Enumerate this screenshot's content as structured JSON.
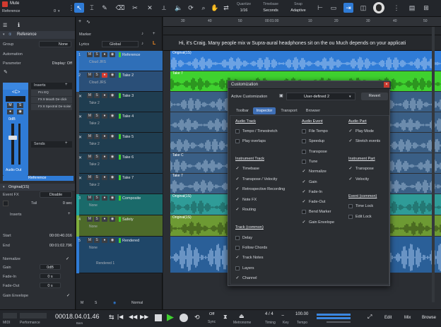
{
  "toolbar": {
    "mute_label": "Mute",
    "track_name": "Reference",
    "counter": "0",
    "quantize_label": "Quantize",
    "quantize_value": "1/16",
    "timebase_label": "Timebase",
    "timebase_value": "Seconds",
    "snap_label": "Snap",
    "snap_value": "Adaptive"
  },
  "inspector": {
    "title": "Reference",
    "group_label": "Group",
    "group_value": "None",
    "automation_label": "Automation",
    "parameter_label": "Parameter",
    "parameter_value": "Display: Off",
    "inserts_label": "Inserts",
    "insert_items": [
      "Pro EQ",
      "FX 9 Mouth De-click",
      "FX 8 Spectral De-noise"
    ],
    "channel_label": "<C>",
    "fader_value": "0dB",
    "sends_label": "Sends",
    "audio_out": "Audio Out",
    "channel_name": "Reference",
    "event_name": "Original(1S)",
    "event_fx_label": "Event FX",
    "event_fx_value": "Disable",
    "tail_label": "Tail",
    "tail_value": "0 sec",
    "event_inserts": "Inserts",
    "start_label": "Start",
    "start_value": "00:00:40.016",
    "end_label": "End",
    "end_value": "00:01:02.796",
    "normalize_label": "Normalize",
    "gain_label": "Gain",
    "gain_value": "0dB",
    "fadein_label": "Fade-In",
    "fadein_value": "0 s",
    "fadeout_label": "Fade-Out",
    "fadeout_value": "0 s",
    "gain_env_label": "Gain Envelope"
  },
  "tracklist": {
    "marker_label": "Marker",
    "lyrics_label": "Lyrics",
    "lyrics_value": "Global",
    "tracks": [
      {
        "num": "1",
        "name": "Reference",
        "sub": "Cloud JRS",
        "color": "#2f7bd6"
      },
      {
        "num": "2",
        "name": "Take 2",
        "sub": "Cloud JRS",
        "color": "#2f7bd6"
      },
      {
        "num": "",
        "name": "Take 3",
        "sub": "Take 2",
        "color": "#3a3e44"
      },
      {
        "num": "",
        "name": "Take 4",
        "sub": "Take 2",
        "color": "#3a3e44"
      },
      {
        "num": "",
        "name": "Take 5",
        "sub": "Take 2",
        "color": "#3a3e44"
      },
      {
        "num": "",
        "name": "Take 6",
        "sub": "Take 2",
        "color": "#3a3e44"
      },
      {
        "num": "",
        "name": "Take 7",
        "sub": "Take 2",
        "color": "#3a3e44"
      },
      {
        "num": "3",
        "name": "Composite",
        "sub": "None",
        "color": "#23a5a0"
      },
      {
        "num": "4",
        "name": "Safety",
        "sub": "None",
        "color": "#7fae3b"
      },
      {
        "num": "5",
        "name": "Rendered",
        "sub": "None",
        "color": "#2f7bd6"
      }
    ],
    "rendered_sub": "Rendered 1",
    "bottom_mode": "Normal"
  },
  "arrange": {
    "ruler": [
      "30",
      "40",
      "50",
      "00:01:00",
      "10",
      "20",
      "30",
      "40",
      "50"
    ],
    "lyrics_text": "Hi, it's Craig. Many people mix w Supra-aural headphones sit on the ou Much depends on your applicati",
    "clip_label": "Original(1S)",
    "take_label": "Take 7",
    "take_c_label": "Take C"
  },
  "dialog": {
    "title": "Customization",
    "active_label": "Active Customization",
    "preset_value": "User-defined 2",
    "revert_label": "Revert",
    "tabs": [
      "Toolbar",
      "Inspector",
      "Transport",
      "Browser"
    ],
    "col1": {
      "audio_track": "Audio Track",
      "audio_track_items": [
        {
          "label": "Tempo / Timestretch",
          "checked": false
        },
        {
          "label": "Play overlaps",
          "checked": false
        }
      ],
      "instrument_track": "Instrument Track",
      "instrument_track_items": [
        {
          "label": "Timebase",
          "checked": true
        },
        {
          "label": "Transpose / Velocity",
          "checked": true
        },
        {
          "label": "Retrospective Recording",
          "checked": true
        },
        {
          "label": "Note FX",
          "checked": true
        },
        {
          "label": "Routing",
          "checked": true
        }
      ],
      "track_common": "Track (common)",
      "track_common_items": [
        {
          "label": "Delay",
          "checked": false
        },
        {
          "label": "Follow Chords",
          "checked": false
        },
        {
          "label": "Track Notes",
          "checked": true
        },
        {
          "label": "Layers",
          "checked": false
        },
        {
          "label": "Channel",
          "checked": true
        }
      ]
    },
    "col2": {
      "audio_event": "Audio Event",
      "items": [
        {
          "label": "File Tempo",
          "checked": false
        },
        {
          "label": "Speedup",
          "checked": false
        },
        {
          "label": "Transpose",
          "checked": false
        },
        {
          "label": "Tune",
          "checked": false
        },
        {
          "label": "Normalize",
          "checked": true
        },
        {
          "label": "Gain",
          "checked": true
        },
        {
          "label": "Fade-In",
          "checked": true
        },
        {
          "label": "Fade-Out",
          "checked": true
        },
        {
          "label": "Bend Marker",
          "checked": false
        },
        {
          "label": "Gain Envelope",
          "checked": true
        }
      ]
    },
    "col3": {
      "audio_part": "Audio Part",
      "audio_part_items": [
        {
          "label": "Play Mode",
          "checked": true
        },
        {
          "label": "Stretch events",
          "checked": true
        }
      ],
      "instrument_part": "Instrument Part",
      "instrument_part_items": [
        {
          "label": "Transpose",
          "checked": true
        },
        {
          "label": "Velocity",
          "checked": true
        }
      ],
      "event_common": "Event (common)",
      "event_common_items": [
        {
          "label": "Time Lock",
          "checked": false
        },
        {
          "label": "Edit Lock",
          "checked": false
        }
      ]
    }
  },
  "transport": {
    "midi_label": "MIDI",
    "performance_label": "Performance",
    "time_value": "00018.04.01.46",
    "time_unit": "Bars",
    "sync_value": "Off",
    "sync_label": "Sync",
    "metronome_label": "Metronome",
    "timing_value": "4 / 4",
    "timing_label": "Timing",
    "key_label": "Key",
    "tempo_value": "100.00",
    "tempo_label": "Tempo",
    "edit_label": "Edit",
    "mix_label": "Mix",
    "browse_label": "Browse"
  },
  "colors": {
    "accent": "#2f7bd6",
    "take_green": "#3fd12f",
    "teal": "#23a5a0",
    "olive": "#7fae3b"
  }
}
